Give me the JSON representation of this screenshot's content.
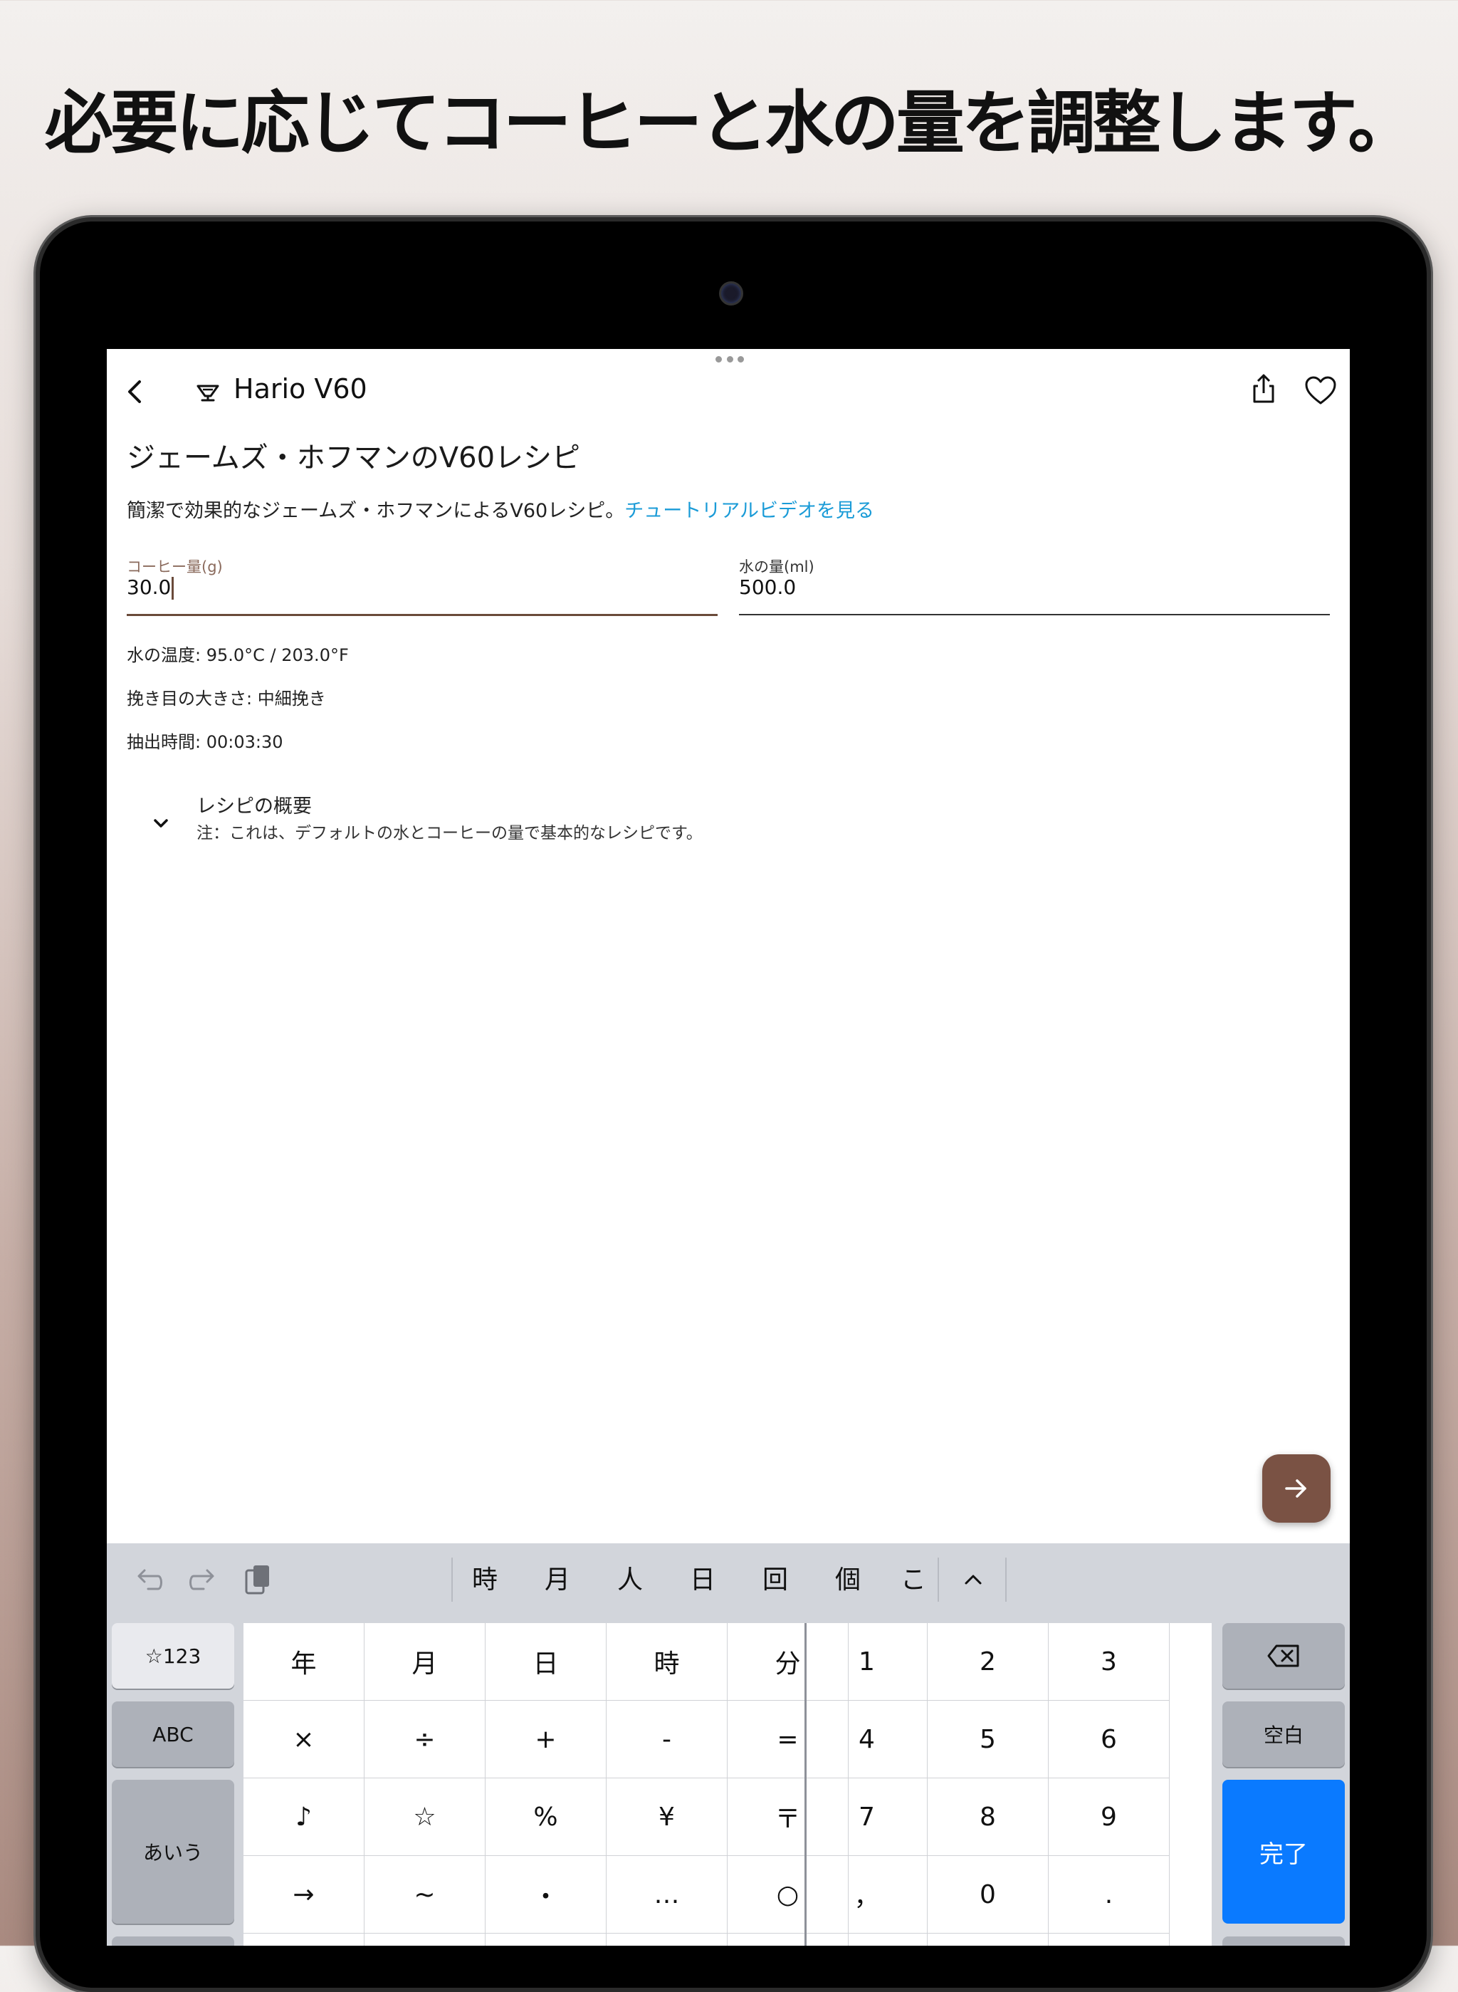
{
  "headline": "必要に応じてコーヒーと水の量を調整します。",
  "appbar": {
    "title": "Hario V60"
  },
  "recipe": {
    "title": "ジェームズ・ホフマンのV60レシピ",
    "description": "簡潔で効果的なジェームズ・ホフマンによるV60レシピ。",
    "video_link": "チュートリアルビデオを見る"
  },
  "coffee_field": {
    "label": "コーヒー量(g)",
    "value": "30.0"
  },
  "water_field": {
    "label": "水の量(ml)",
    "value": "500.0"
  },
  "info": {
    "temperature": "水の温度: 95.0°C / 203.0°F",
    "grind": "挽き目の大きさ: 中細挽き",
    "brew_time": "抽出時間: 00:03:30"
  },
  "summary": {
    "title": "レシピの概要",
    "note": "注：これは、デフォルトの水とコーヒーの量で基本的なレシピです。"
  },
  "colors": {
    "accent": "#7a5244",
    "link": "#1a9bd7",
    "done_key": "#0a7aff"
  },
  "keyboard": {
    "candidates": [
      "時",
      "月",
      "人",
      "日",
      "回",
      "個",
      "こ"
    ],
    "side_keys": {
      "symbols": "☆123",
      "abc": "ABC",
      "kana": "あいう",
      "space": "空白",
      "done": "完了"
    },
    "grid_left": [
      [
        "年",
        "月",
        "日",
        "時",
        "分"
      ],
      [
        "×",
        "÷",
        "+",
        "-",
        "="
      ],
      [
        "♪",
        "☆",
        "%",
        "¥",
        "〒"
      ],
      [
        "→",
        "~",
        "・",
        "…",
        "○"
      ]
    ],
    "grid_right": [
      [
        "1",
        "2",
        "3"
      ],
      [
        "4",
        "5",
        "6"
      ],
      [
        "7",
        "8",
        "9"
      ],
      [
        "，",
        "0",
        "."
      ]
    ]
  }
}
